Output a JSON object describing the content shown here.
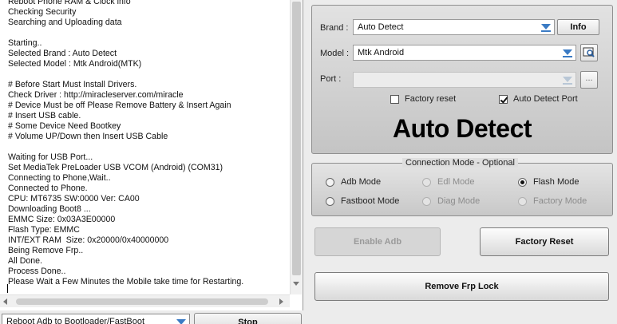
{
  "log": {
    "lines": [
      "Reboot Phone RAM & Clock info",
      "Checking Security",
      "Searching and Uploading data",
      "",
      "Starting..",
      "Selected Brand : Auto Detect",
      "Selected Model : Mtk Android(MTK)",
      "",
      "# Before Start Must Install Drivers.",
      "Check Driver : http://miracleserver.com/miracle",
      "# Device Must be off Please Remove Battery & Insert Again",
      "# Insert USB cable.",
      "# Some Device Need Bootkey",
      "# Volume UP/Down then Insert USB Cable",
      "",
      "Waiting for USB Port...",
      "Set MediaTek PreLoader USB VCOM (Android) (COM31)",
      "Connecting to Phone,Wait..",
      "Connected to Phone.",
      "CPU: MT6735 SW:0000 Ver: CA00",
      "Downloading Boot8 ...",
      "EMMC Size: 0x03A3E00000",
      "Flash Type: EMMC",
      "INT/EXT RAM  Size: 0x20000/0x40000000",
      "Being Remove Frp..",
      "All Done.",
      "Process Done..",
      "Please Wait a Few Minutes the Mobile take time for Restarting."
    ]
  },
  "bottom": {
    "reboot_option": "Reboot Adb to Bootloader/FastBoot",
    "stop_label": "Stop"
  },
  "device": {
    "brand_label": "Brand :",
    "brand_value": "Auto Detect",
    "info_label": "Info",
    "model_label": "Model :",
    "model_value": "Mtk Android",
    "port_label": "Port :",
    "port_value": "",
    "port_browse_label": "...",
    "factory_reset_label": "Factory reset",
    "factory_reset_checked": false,
    "auto_detect_port_label": "Auto Detect Port",
    "auto_detect_port_checked": true,
    "detected_title": "Auto Detect"
  },
  "connection": {
    "title": "Connection Mode - Optional",
    "modes": [
      {
        "label": "Adb Mode",
        "selected": false,
        "enabled": true
      },
      {
        "label": "Edl Mode",
        "selected": false,
        "enabled": false
      },
      {
        "label": "Flash Mode",
        "selected": true,
        "enabled": true
      },
      {
        "label": "Fastboot Mode",
        "selected": false,
        "enabled": true
      },
      {
        "label": "Diag Mode",
        "selected": false,
        "enabled": false
      },
      {
        "label": "Factory Mode",
        "selected": false,
        "enabled": false
      }
    ]
  },
  "actions": {
    "enable_adb_label": "Enable Adb",
    "enable_adb_enabled": false,
    "factory_reset_label": "Factory Reset",
    "remove_frp_label": "Remove Frp Lock"
  },
  "colors": {
    "dropdown_icon": "#3b7bc4",
    "panel_gradient_top": "#e2e2e2",
    "panel_gradient_bottom": "#c4c4c4"
  }
}
